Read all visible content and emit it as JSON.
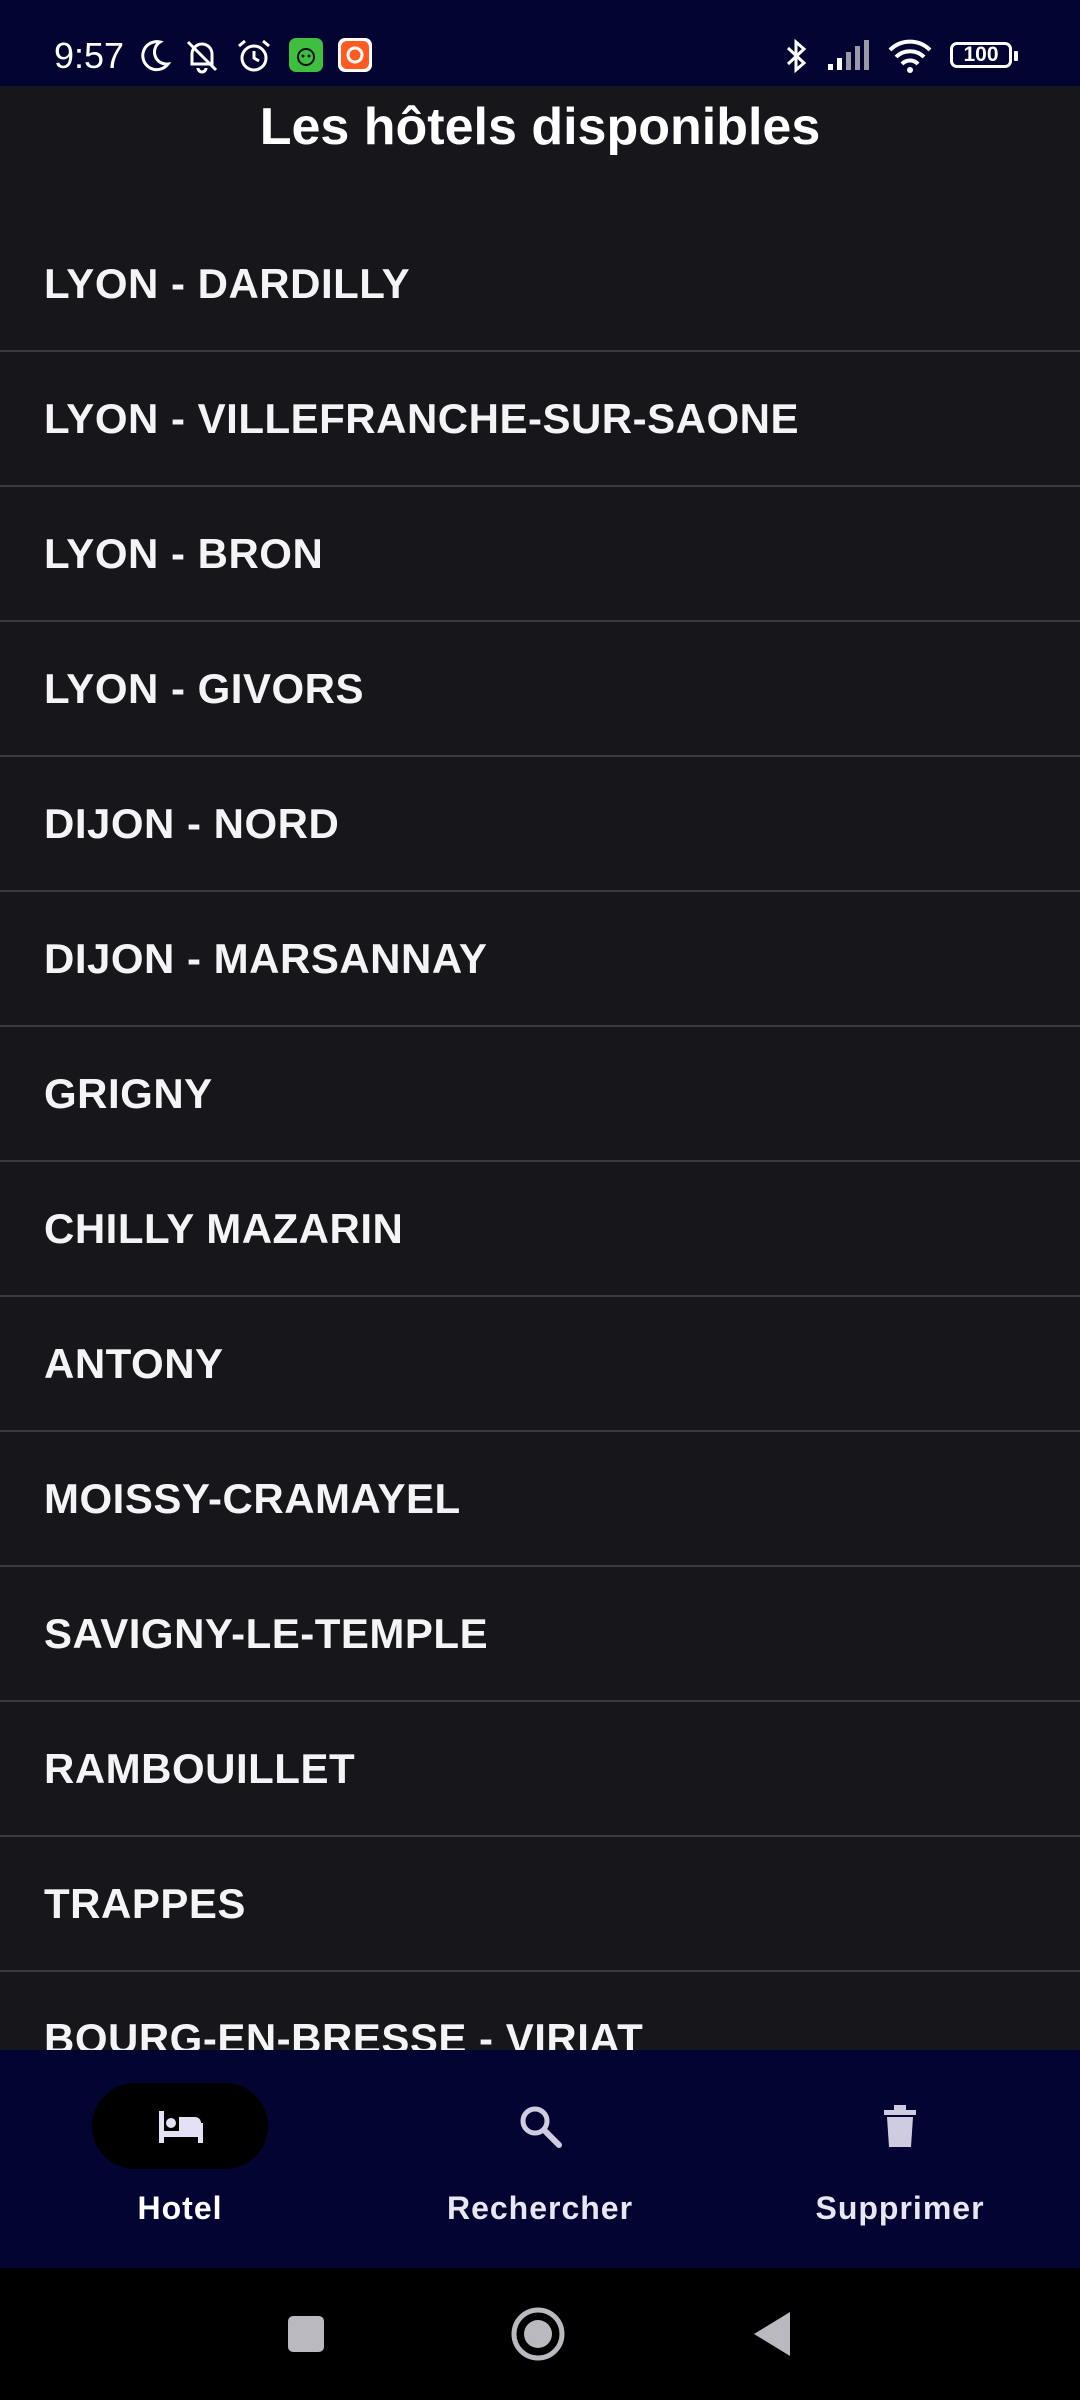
{
  "status_bar": {
    "time": "9:57",
    "battery": "100",
    "icons": [
      "moon-icon",
      "bell-off-icon",
      "alarm-icon",
      "green-app-icon",
      "orange-app-icon",
      "bluetooth-icon",
      "signal-icon",
      "wifi-icon",
      "battery-icon"
    ]
  },
  "header": {
    "title": "Les hôtels disponibles"
  },
  "hotels": [
    "LYON - DARDILLY",
    "LYON - VILLEFRANCHE-SUR-SAONE",
    "LYON - BRON",
    "LYON - GIVORS",
    "DIJON - NORD",
    "DIJON - MARSANNAY",
    "GRIGNY",
    "CHILLY MAZARIN",
    "ANTONY",
    "MOISSY-CRAMAYEL",
    "SAVIGNY-LE-TEMPLE",
    "RAMBOUILLET",
    "TRAPPES",
    "BOURG-EN-BRESSE - VIRIAT"
  ],
  "bottom_nav": {
    "items": [
      {
        "label": "Hotel",
        "icon": "bed-icon",
        "selected": true
      },
      {
        "label": "Rechercher",
        "icon": "search-icon",
        "selected": false
      },
      {
        "label": "Supprimer",
        "icon": "trash-icon",
        "selected": false
      }
    ]
  },
  "colors": {
    "background": "#17161b",
    "bars": "#040433",
    "divider": "#3b3a40",
    "text": "#ffffff"
  }
}
